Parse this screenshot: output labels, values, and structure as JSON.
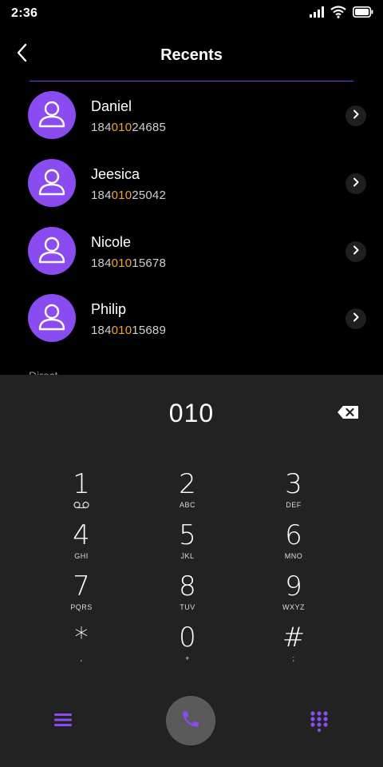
{
  "status_bar": {
    "time": "2:36"
  },
  "header": {
    "title": "Recents"
  },
  "recents": [
    {
      "name": "Daniel",
      "number_prefix": "184",
      "number_match": "010",
      "number_suffix": "24685"
    },
    {
      "name": "Jeesica",
      "number_prefix": "184",
      "number_match": "010",
      "number_suffix": "25042"
    },
    {
      "name": "Nicole",
      "number_prefix": "184",
      "number_match": "010",
      "number_suffix": "15678"
    },
    {
      "name": "Philip",
      "number_prefix": "184",
      "number_match": "010",
      "number_suffix": "15689"
    }
  ],
  "section_peek": "Direct",
  "dialpad": {
    "display_value": "010",
    "keys": [
      {
        "digit": "1",
        "letters": ""
      },
      {
        "digit": "2",
        "letters": "ABC"
      },
      {
        "digit": "3",
        "letters": "DEF"
      },
      {
        "digit": "4",
        "letters": "GHI"
      },
      {
        "digit": "5",
        "letters": "JKL"
      },
      {
        "digit": "6",
        "letters": "MNO"
      },
      {
        "digit": "7",
        "letters": "PQRS"
      },
      {
        "digit": "8",
        "letters": "TUV"
      },
      {
        "digit": "9",
        "letters": "WXYZ"
      },
      {
        "digit": "*",
        "letters": ","
      },
      {
        "digit": "0",
        "letters": "+"
      },
      {
        "digit": "#",
        "letters": ";"
      }
    ]
  },
  "icons": {
    "voicemail": "voicemail-icon",
    "back": "chevron-left-icon",
    "row_chevron": "chevron-right-icon",
    "backspace": "backspace-icon",
    "menu": "menu-icon",
    "call": "phone-icon",
    "keypad": "dialpad-icon"
  },
  "colors": {
    "accent": "#8a4bf0",
    "highlight": "#f5a623",
    "background": "#000000",
    "sheet": "#222222"
  }
}
